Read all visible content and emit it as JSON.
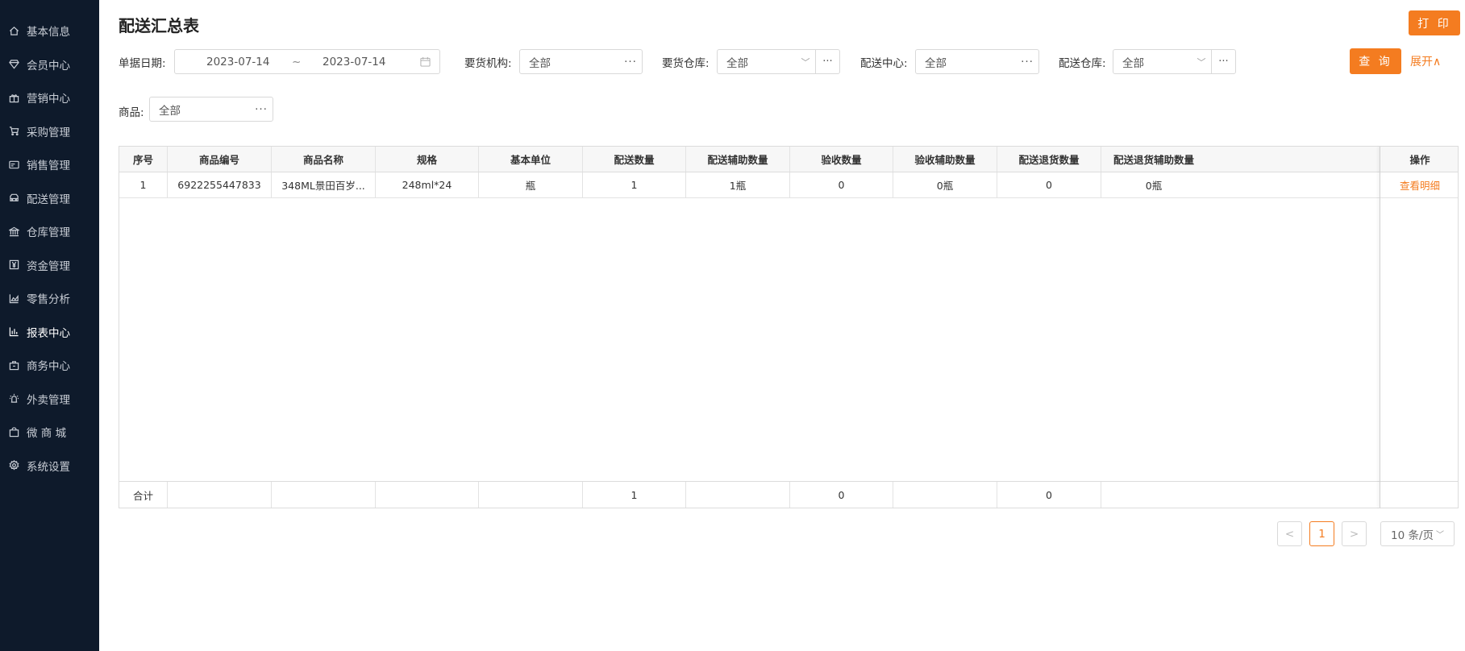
{
  "sidebar": {
    "items": [
      {
        "label": "基本信息",
        "icon": "home-icon"
      },
      {
        "label": "会员中心",
        "icon": "diamond-icon"
      },
      {
        "label": "营销中心",
        "icon": "gift-icon"
      },
      {
        "label": "采购管理",
        "icon": "cart-icon"
      },
      {
        "label": "销售管理",
        "icon": "card-icon"
      },
      {
        "label": "配送管理",
        "icon": "truck-icon"
      },
      {
        "label": "仓库管理",
        "icon": "bank-icon"
      },
      {
        "label": "资金管理",
        "icon": "yen-icon"
      },
      {
        "label": "零售分析",
        "icon": "area-chart-icon"
      },
      {
        "label": "报表中心",
        "icon": "bar-chart-icon"
      },
      {
        "label": "商务中心",
        "icon": "briefcase-icon"
      },
      {
        "label": "外卖管理",
        "icon": "alarm-icon"
      },
      {
        "label": "微 商 城",
        "icon": "shopping-bag-icon"
      },
      {
        "label": "系统设置",
        "icon": "gear-icon"
      }
    ],
    "active_index": 9
  },
  "header": {
    "title": "配送汇总表",
    "print_label": "打 印"
  },
  "filters": {
    "date_label": "单据日期:",
    "date_start": "2023-07-14",
    "date_sep": "~",
    "date_end": "2023-07-14",
    "org_label": "要货机构:",
    "org_value": "全部",
    "req_wh_label": "要货仓库:",
    "req_wh_value": "全部",
    "center_label": "配送中心:",
    "center_value": "全部",
    "dist_wh_label": "配送仓库:",
    "dist_wh_value": "全部",
    "goods_label": "商品:",
    "goods_value": "全部",
    "more_glyph": "···",
    "query_label": "查 询",
    "expand_label": "展开∧"
  },
  "table": {
    "columns": [
      "序号",
      "商品编号",
      "商品名称",
      "规格",
      "基本单位",
      "配送数量",
      "配送辅助数量",
      "验收数量",
      "验收辅助数量",
      "配送退货数量",
      "配送退货辅助数量",
      "操作"
    ],
    "rows": [
      [
        "1",
        "6922255447833",
        "348ML景田百岁...",
        "248ml*24",
        "瓶",
        "1",
        "1瓶",
        "0",
        "0瓶",
        "0",
        "0瓶",
        "查看明细"
      ]
    ],
    "footer": [
      "合计",
      "",
      "",
      "",
      "",
      "1",
      "",
      "0",
      "",
      "0",
      "",
      ""
    ]
  },
  "pager": {
    "prev": "<",
    "current": "1",
    "next": ">",
    "page_size": "10 条/页"
  },
  "colors": {
    "accent": "#f47c20",
    "sidebar_bg": "#0e1a2b"
  }
}
